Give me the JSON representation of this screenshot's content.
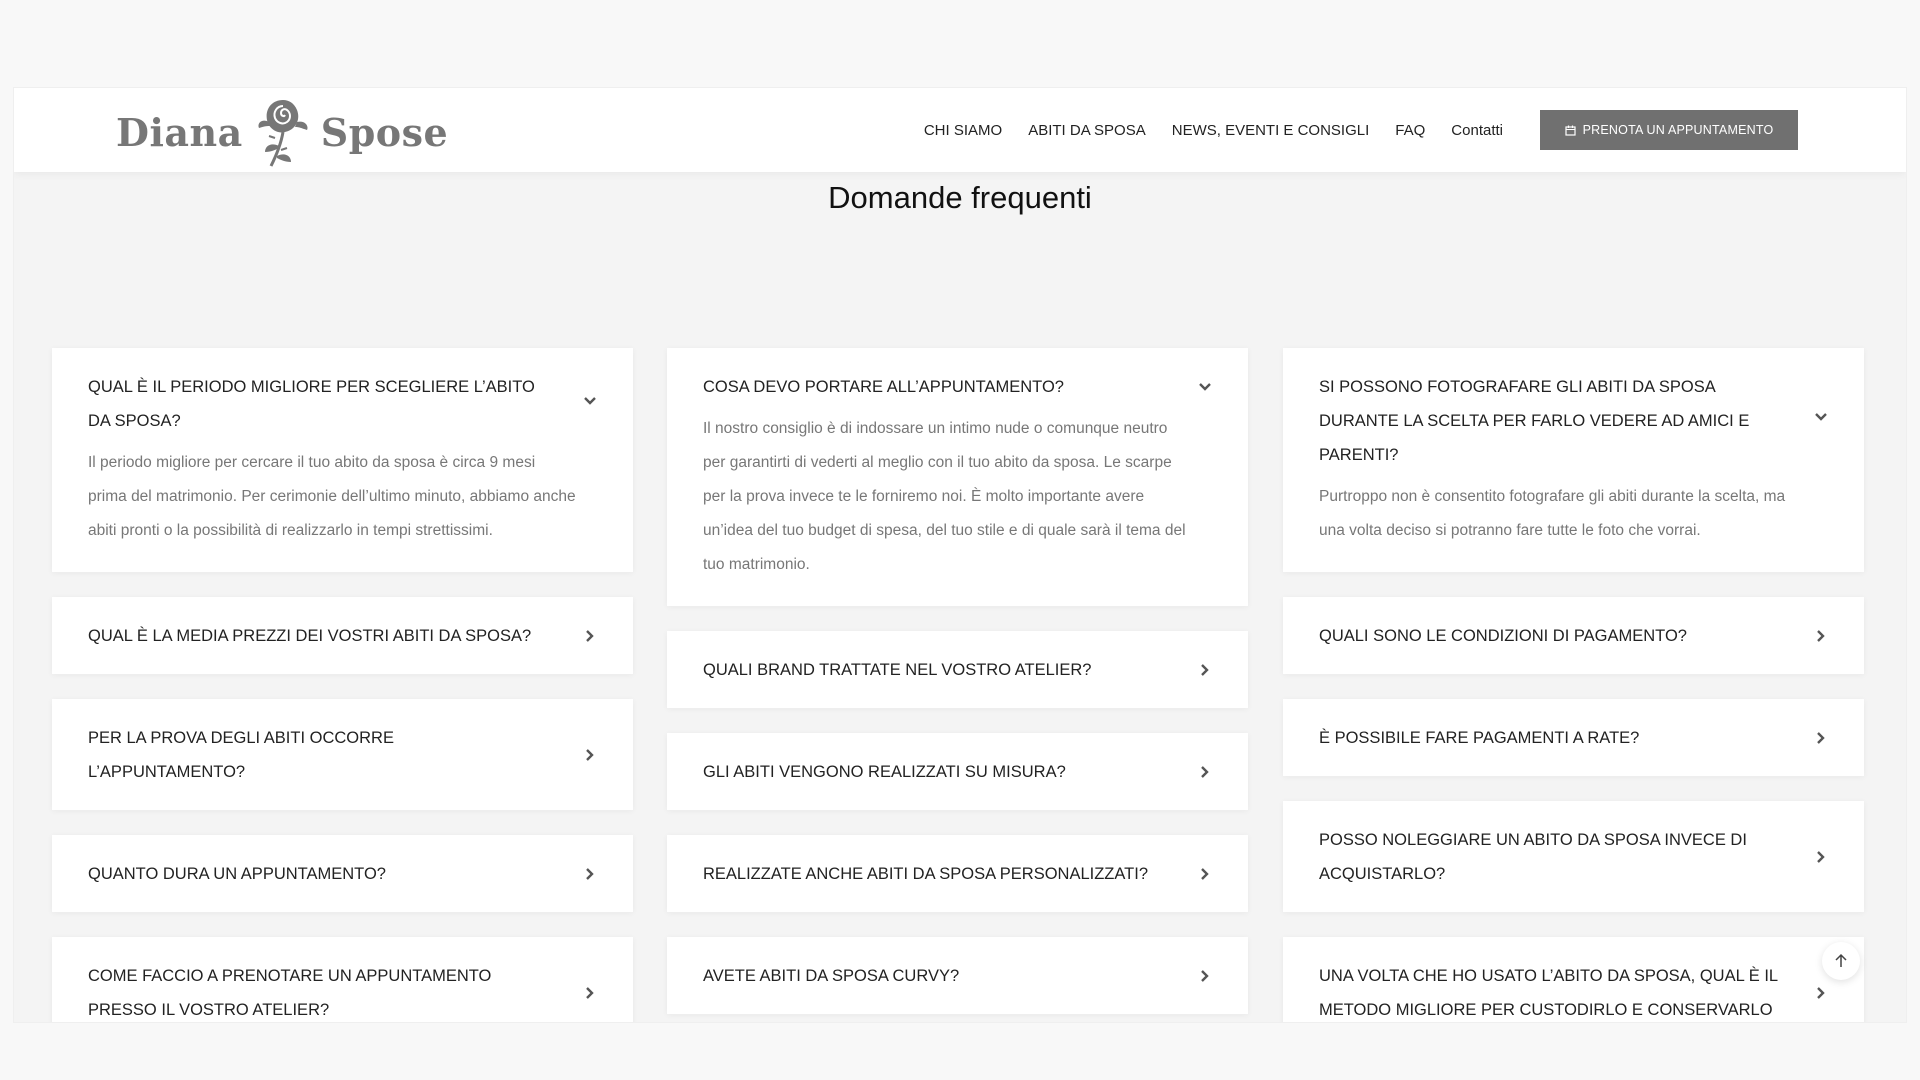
{
  "header": {
    "logo_left": "Diana",
    "logo_right": "Spose",
    "nav": [
      {
        "label": "CHI SIAMO"
      },
      {
        "label": "ABITI DA SPOSA"
      },
      {
        "label": "NEWS, EVENTI E CONSIGLI"
      },
      {
        "label": "FAQ"
      },
      {
        "label": "Contatti"
      }
    ],
    "cta_label": "PRENOTA UN APPUNTAMENTO",
    "cta_icon": "calendar-icon"
  },
  "page_title": "Domande frequenti",
  "faq": {
    "col1": [
      {
        "q": "QUAL È IL PERIODO MIGLIORE PER SCEGLIERE L’ABITO DA SPOSA?",
        "a": "Il periodo migliore per cercare il tuo abito da sposa è circa 9 mesi prima del matrimonio. Per cerimonie dell’ultimo minuto, abbiamo anche abiti pronti o la possibilità di realizzarlo in tempi strettissimi."
      },
      {
        "q": "QUAL È LA MEDIA PREZZI DEI VOSTRI ABITI DA SPOSA?"
      },
      {
        "q": "PER LA PROVA DEGLI ABITI OCCORRE L’APPUNTAMENTO?"
      },
      {
        "q": "QUANTO DURA UN APPUNTAMENTO?"
      },
      {
        "q": "COME FACCIO A PRENOTARE UN APPUNTAMENTO PRESSO IL VOSTRO ATELIER?"
      }
    ],
    "col2": [
      {
        "q": "COSA DEVO PORTARE ALL’APPUNTAMENTO?",
        "a": "Il nostro consiglio è di indossare un intimo nude o comunque neutro per garantirti di vederti al meglio con il tuo abito da sposa. Le scarpe per la prova invece te le forniremo noi. È molto importante avere un’idea del tuo budget di spesa, del tuo stile e di quale sarà il tema del tuo matrimonio."
      },
      {
        "q": "QUALI BRAND TRATTATE NEL VOSTRO ATELIER?"
      },
      {
        "q": "GLI ABITI VENGONO REALIZZATI SU MISURA?"
      },
      {
        "q": "REALIZZATE ANCHE ABITI DA SPOSA PERSONALIZZATI?"
      },
      {
        "q": "AVETE ABITI DA SPOSA CURVY?"
      }
    ],
    "col3": [
      {
        "q": "SI POSSONO FOTOGRAFARE GLI ABITI DA SPOSA DURANTE LA SCELTA PER FARLO VEDERE AD AMICI E PARENTI?",
        "a": "Purtroppo non è consentito fotografare gli abiti durante la scelta, ma una volta deciso si potranno fare tutte le foto che vorrai."
      },
      {
        "q": "QUALI SONO LE CONDIZIONI DI PAGAMENTO?"
      },
      {
        "q": "È POSSIBILE FARE PAGAMENTI A RATE?"
      },
      {
        "q": "POSSO NOLEGGIARE UN ABITO DA SPOSA INVECE DI ACQUISTARLO?"
      },
      {
        "q": "UNA VOLTA CHE HO USATO L’ABITO DA SPOSA, QUAL È IL METODO MIGLIORE PER CUSTODIRLO E CONSERVARLO"
      }
    ]
  },
  "scroll_top_icon": "arrow-up-icon"
}
